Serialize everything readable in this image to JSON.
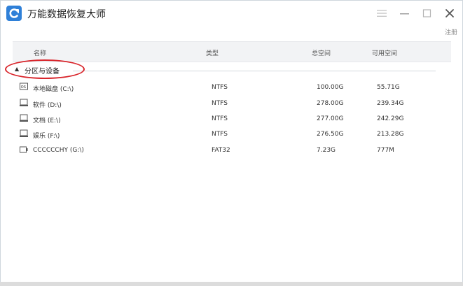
{
  "window": {
    "title": "万能数据恢复大师",
    "register_label": "注册"
  },
  "table": {
    "headers": {
      "name": "名称",
      "type": "类型",
      "total": "总空间",
      "free": "可用空间"
    },
    "group": {
      "label": "分区与设备",
      "expanded": true
    },
    "rows": [
      {
        "icon": "system-drive-icon",
        "name": "本地磁盘 (C:\\)",
        "type": "NTFS",
        "total": "100.00G",
        "free": "55.71G"
      },
      {
        "icon": "drive-icon",
        "name": "软件 (D:\\)",
        "type": "NTFS",
        "total": "278.00G",
        "free": "239.34G"
      },
      {
        "icon": "drive-icon",
        "name": "文档 (E:\\)",
        "type": "NTFS",
        "total": "277.00G",
        "free": "242.29G"
      },
      {
        "icon": "drive-icon",
        "name": "娱乐 (F:\\)",
        "type": "NTFS",
        "total": "276.50G",
        "free": "213.28G"
      },
      {
        "icon": "usb-drive-icon",
        "name": "CCCCCCHY (G:\\)",
        "type": "FAT32",
        "total": "7.23G",
        "free": "777M"
      }
    ]
  },
  "annotation": {
    "highlight_color": "#d9262c"
  },
  "colors": {
    "accent": "#2f80d8"
  }
}
